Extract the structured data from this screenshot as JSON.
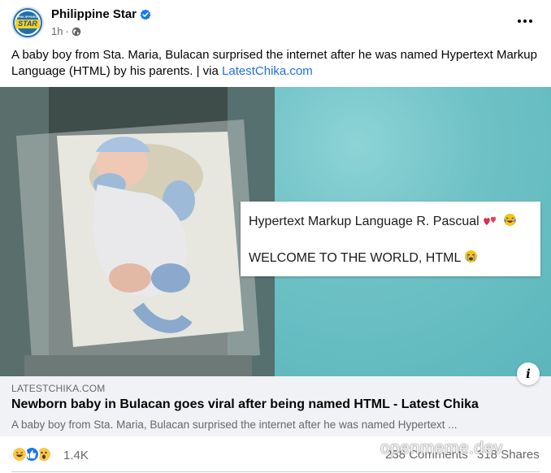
{
  "post": {
    "page_name": "Philippine Star",
    "time": "1h",
    "caption_text": "A baby boy from Sta. Maria, Bulacan surprised the internet after he was named Hypertext Markup Language (HTML) by his parents. | via ",
    "caption_link": "LatestChika.com",
    "avatar_top": "PHILIPPINES",
    "avatar_main": "STAR"
  },
  "image": {
    "note_line1": "Hypertext Markup Language R. Pascual",
    "note_line2": "WELCOME TO THE WORLD, HTML"
  },
  "link": {
    "domain": "LATESTCHIKA.COM",
    "title": "Newborn baby in Bulacan goes viral after being named HTML - Latest Chika",
    "description": "A baby boy from Sta. Maria, Bulacan surprised the internet after he was named Hypertext ...",
    "info_icon": "i"
  },
  "stats": {
    "reactions": "1.4K",
    "comments": "238 Comments",
    "shares": "318 Shares",
    "watermark": "openmeme.dev"
  },
  "colors": {
    "link_blue": "#216fdb",
    "verified_blue": "#1877f2",
    "preview_bg": "#f0f2f5",
    "secondary_text": "#65676b"
  },
  "icons": {
    "verified": "verified-badge-icon",
    "audience": "globe-icon",
    "more": "more-dots-icon",
    "info": "info-icon",
    "reaction_1": "haha-reaction-icon",
    "reaction_2": "like-reaction-icon",
    "reaction_3": "wow-reaction-icon"
  }
}
